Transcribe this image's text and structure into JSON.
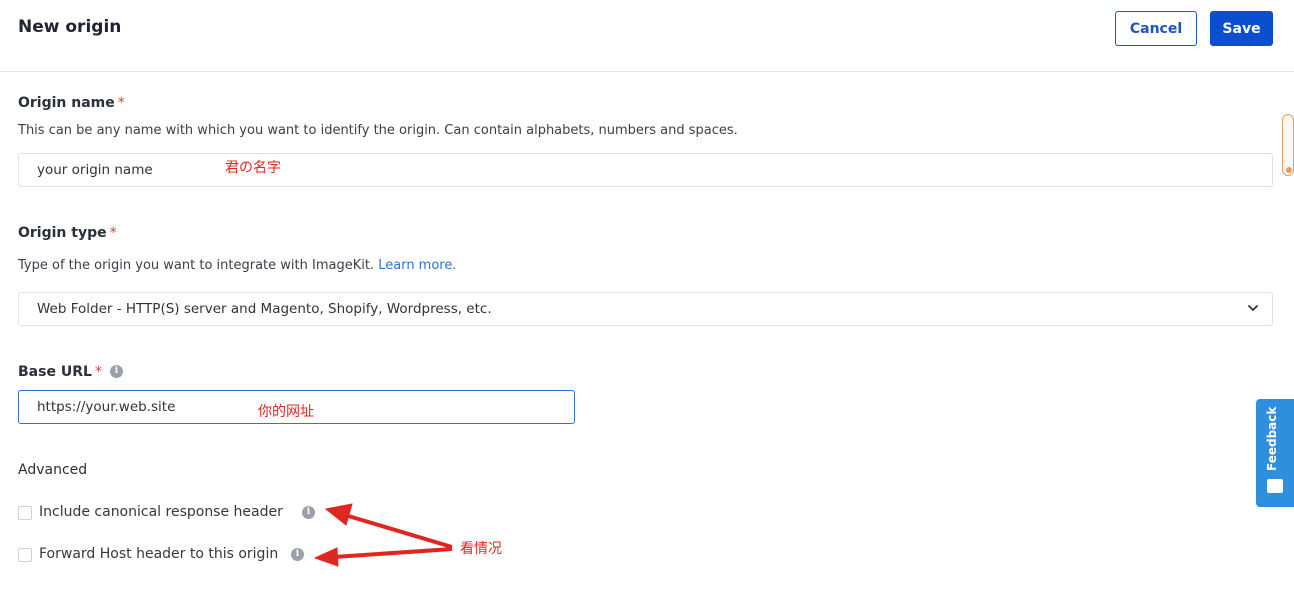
{
  "header": {
    "title": "New origin",
    "cancel_label": "Cancel",
    "save_label": "Save"
  },
  "origin_name": {
    "label": "Origin name",
    "required_mark": "*",
    "description": "This can be any name with which you want to identify the origin. Can contain alphabets, numbers and spaces.",
    "value": "your origin name",
    "annotation": "君の名字"
  },
  "origin_type": {
    "label": "Origin type",
    "required_mark": "*",
    "description": "Type of the origin you want to integrate with ImageKit.",
    "learn_more": "Learn more.",
    "selected": "Web Folder - HTTP(S) server and Magento, Shopify, Wordpress, etc."
  },
  "base_url": {
    "label": "Base URL",
    "required_mark": "*",
    "value": "https://your.web.site",
    "annotation": "你的网址"
  },
  "advanced": {
    "title": "Advanced",
    "options": [
      {
        "label": "Include canonical response header",
        "checked": false
      },
      {
        "label": "Forward Host header to this origin",
        "checked": false
      }
    ],
    "annotation": "看情况"
  },
  "feedback": {
    "label": "Feedback",
    "color": "#2f8fdf"
  },
  "colors": {
    "primary": "#0b4fd0",
    "annotation": "#e0261e",
    "required": "#e23b3b"
  }
}
